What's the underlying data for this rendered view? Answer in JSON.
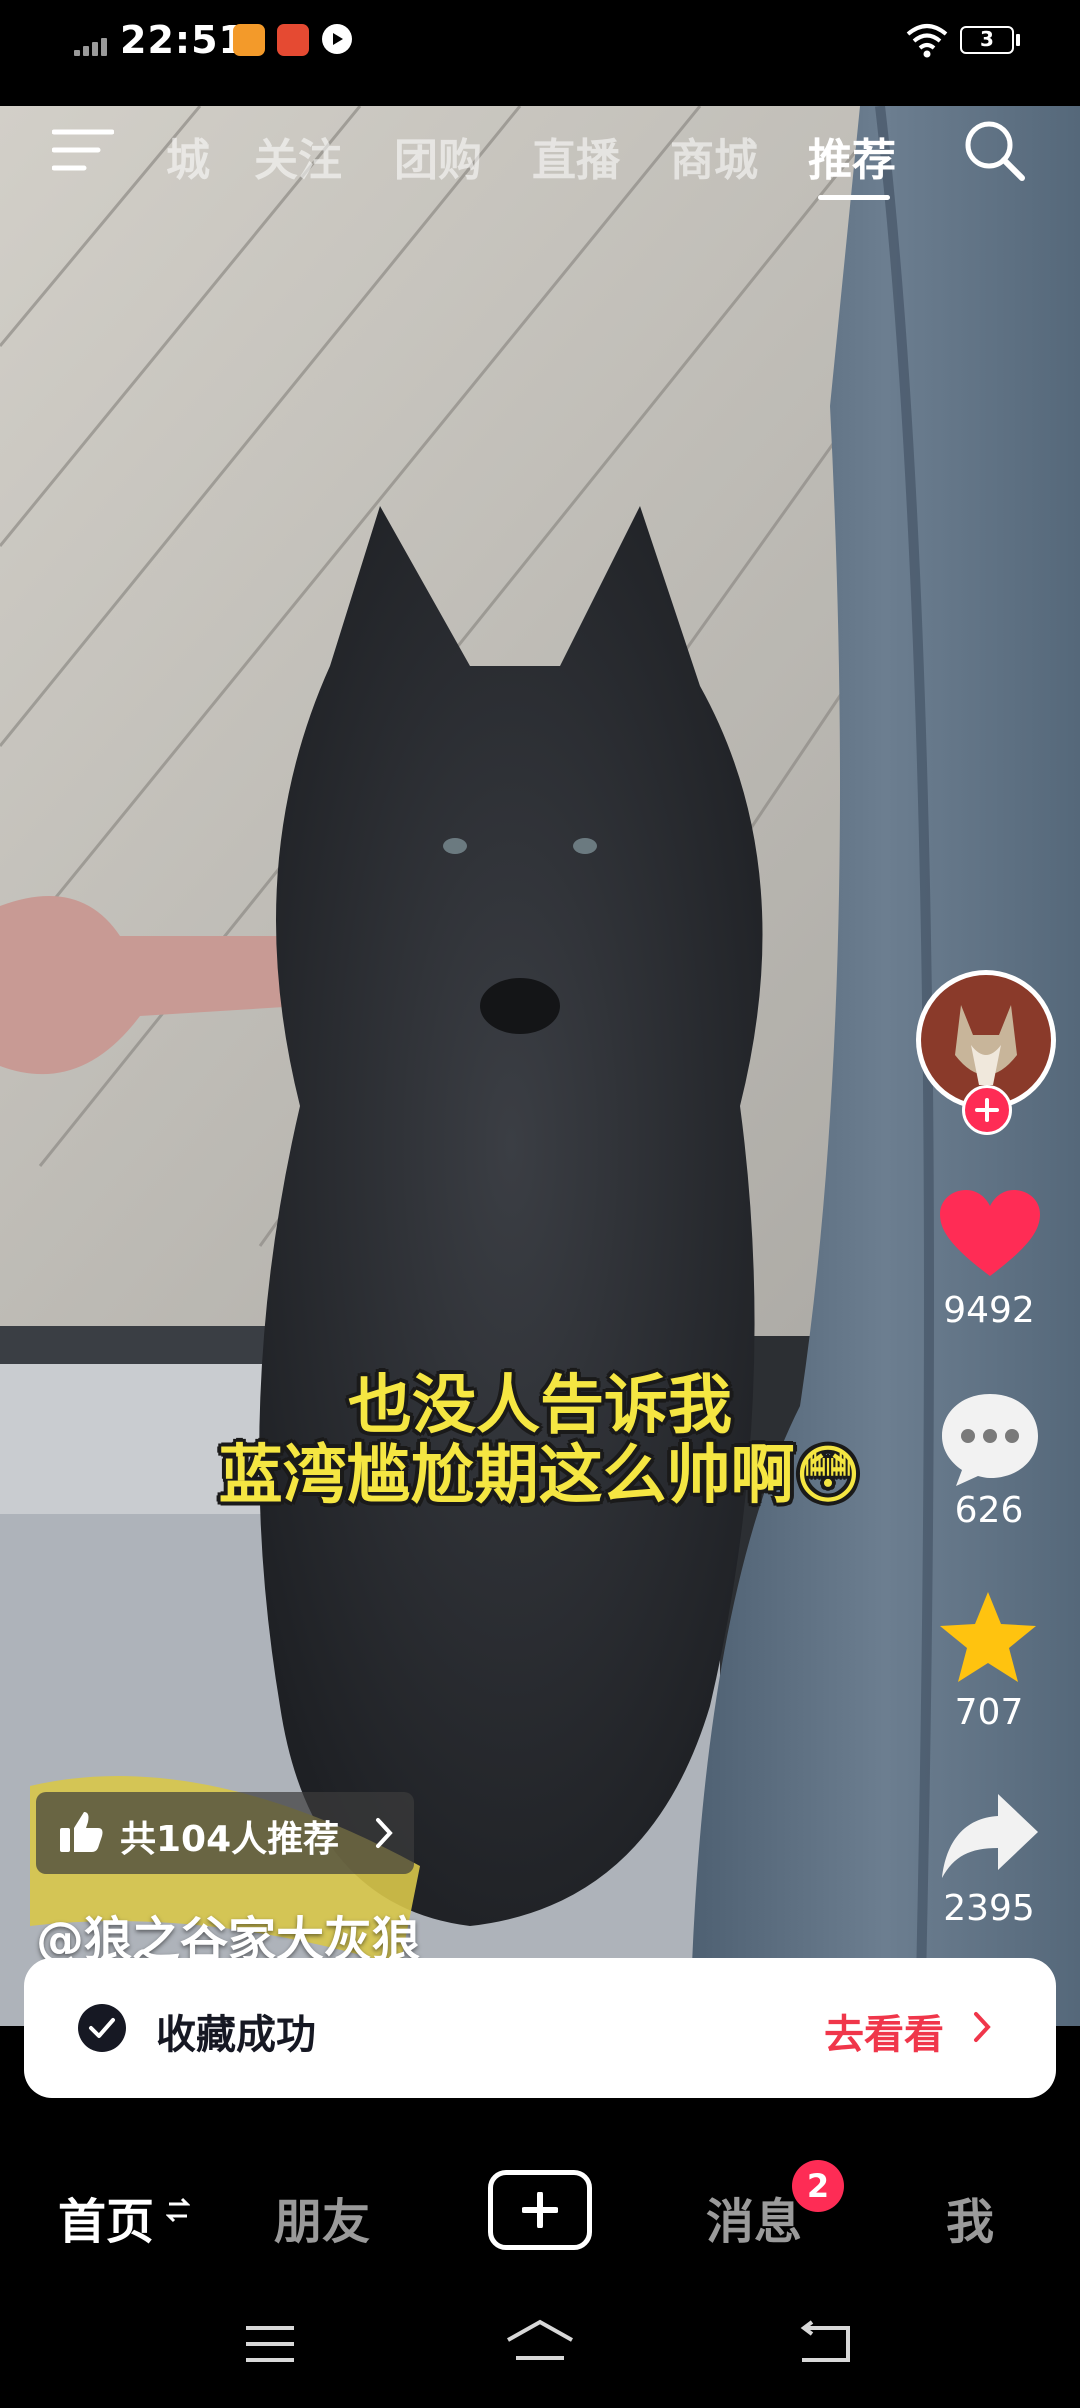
{
  "status_bar": {
    "time": "22:51",
    "battery": "3",
    "icons": [
      "signal-icon",
      "app-icon-1",
      "app-icon-2",
      "app-icon-3",
      "wifi-icon",
      "battery-icon"
    ]
  },
  "top_nav": {
    "tabs": [
      {
        "label": "城",
        "active": false
      },
      {
        "label": "关注",
        "active": false
      },
      {
        "label": "团购",
        "active": false
      },
      {
        "label": "直播",
        "active": false
      },
      {
        "label": "商城",
        "active": false
      },
      {
        "label": "推荐",
        "active": true
      }
    ],
    "icons": [
      "menu-icon",
      "search-icon"
    ]
  },
  "video": {
    "caption_line1": "也没人告诉我",
    "caption_line2": "蓝湾尴尬期这么帅啊😳",
    "recommend_badge": "共104人推荐",
    "author": "@狼之谷家大灰狼"
  },
  "right_rail": {
    "likes": "9492",
    "comments": "626",
    "favorites": "707",
    "shares": "2395",
    "like_color": "#ff2c55",
    "favorite_color": "#ffc30f"
  },
  "toast": {
    "message": "收藏成功",
    "action": "去看看",
    "action_color": "#f0364a"
  },
  "bottom_nav": {
    "home": "首页",
    "friends": "朋友",
    "messages": "消息",
    "messages_badge": "2",
    "me": "我",
    "badge_color": "#fe2c55"
  },
  "system_nav": [
    "menu-nav-icon",
    "home-nav-icon",
    "back-nav-icon"
  ]
}
